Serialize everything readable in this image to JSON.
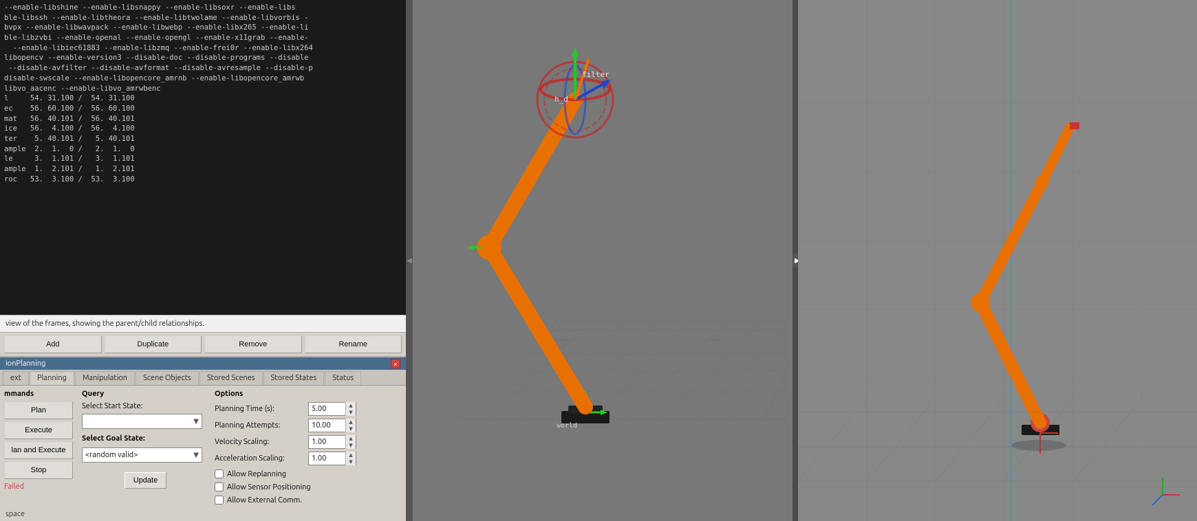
{
  "terminal": {
    "lines": "--enable-libshine --enable-libsnappy --enable-libsoxr --enable-libs\nble-libssh --enable-libtheora --enable-libtwolame --enable-libvorbis -\nbvpx --enable-libwavpack --enable-libwebp --enable-libx265 --enable-li\nble-libzvbi --enable-openal --enable-opengl --enable-x11grab --enable-\n  --enable-libiec61883 --enable-libzmq --enable-frei0r --enable-libx264\nlibopencv --enable-version3 --disable-doc --disable-programs --disable\n --disable-avfilter --disable-avformat --disable-avresample --disable-p\ndisable-swscale --enable-libopencore_amrnb --enable-libopencore_amrwb\nlibvo_aacenc --enable-libvo_amrwbenc\nl     54. 31.100 /  54. 31.100\nec    56. 60.100 /  56. 60.100\nmat   56. 40.101 /  56. 40.101\nice   56.  4.100 /  56.  4.100\nter    5. 40.101 /   5. 40.101\nample  2.  1.  0 /   2.  1.  0\nle     3.  1.101 /   3.  1.101\nample  1.  2.101 /   1.  2.101\nroc   53.  3.100 /  53.  3.100"
  },
  "frame_info": {
    "text": "view of the frames, showing the parent/child relationships."
  },
  "button_bar": {
    "add": "Add",
    "duplicate": "Duplicate",
    "remove": "Remove",
    "rename": "Rename"
  },
  "motion_planning": {
    "title": "ionPlanning",
    "close_label": "×",
    "tabs": [
      {
        "id": "context",
        "label": "ext"
      },
      {
        "id": "planning",
        "label": "Planning",
        "active": true
      },
      {
        "id": "manipulation",
        "label": "Manipulation"
      },
      {
        "id": "scene_objects",
        "label": "Scene Objects"
      },
      {
        "id": "stored_scenes",
        "label": "Stored Scenes"
      },
      {
        "id": "stored_states",
        "label": "Stored States"
      },
      {
        "id": "status",
        "label": "Status"
      }
    ],
    "commands": {
      "label": "mmands",
      "plan_label": "Plan",
      "execute_label": "Execute",
      "plan_execute_label": "lan and Execute",
      "stop_label": "Stop",
      "status_label": "Failed"
    },
    "query": {
      "label": "Query",
      "start_state_label": "Select Start State:",
      "goal_state_label": "Select Goal State:",
      "goal_value": "<random valid>",
      "update_label": "Update"
    },
    "options": {
      "label": "Options",
      "planning_time_label": "Planning Time (s):",
      "planning_time_value": "5.00",
      "planning_attempts_label": "Planning Attempts:",
      "planning_attempts_value": "10.00",
      "velocity_scaling_label": "Velocity Scaling:",
      "velocity_scaling_value": "1.00",
      "acceleration_scaling_label": "Acceleration Scaling:",
      "acceleration_scaling_value": "1.00",
      "allow_replanning_label": "Allow Replanning",
      "allow_sensor_positioning_label": "Allow Sensor Positioning",
      "allow_external_comm_label": "Allow External Comm."
    }
  },
  "workspace_label": "space"
}
